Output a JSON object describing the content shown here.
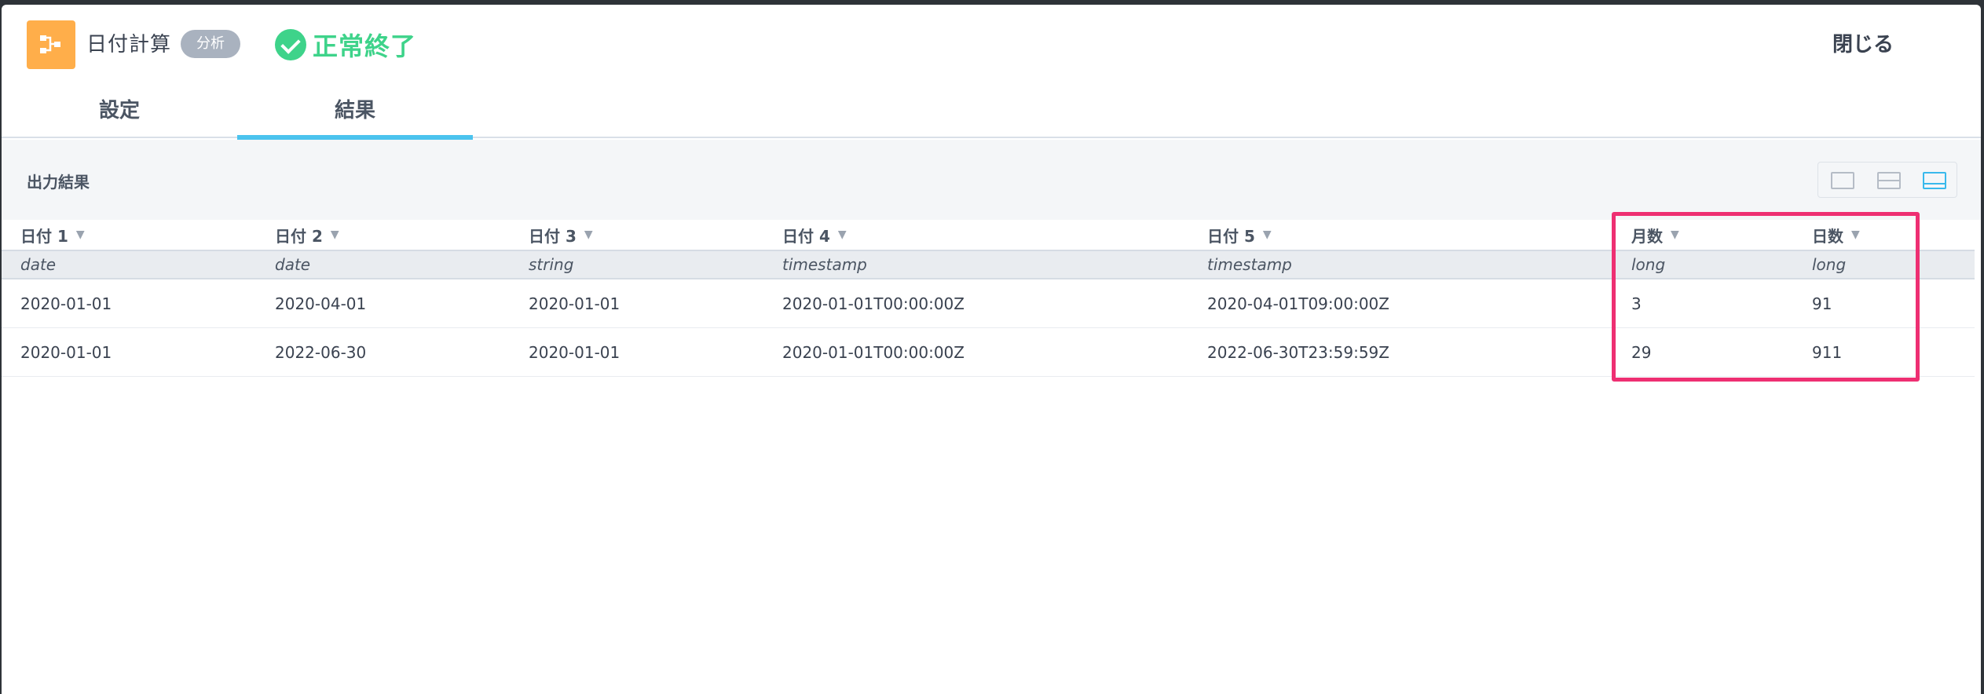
{
  "header": {
    "title": "日付計算",
    "badge": "分析",
    "status": "正常終了",
    "close_label": "閉じる",
    "icon": "flow-node-icon"
  },
  "tabs": [
    {
      "label": "設定",
      "active": false
    },
    {
      "label": "結果",
      "active": true
    }
  ],
  "toolbar": {
    "label": "出力結果",
    "views": [
      "single-pane-icon",
      "split-pane-icon",
      "bottom-pane-icon"
    ],
    "active_view": "bottom-pane-icon"
  },
  "table": {
    "columns": [
      {
        "name": "日付 1",
        "type": "date"
      },
      {
        "name": "日付 2",
        "type": "date"
      },
      {
        "name": "日付 3",
        "type": "string"
      },
      {
        "name": "日付 4",
        "type": "timestamp"
      },
      {
        "name": "日付 5",
        "type": "timestamp"
      },
      {
        "name": "月数",
        "type": "long"
      },
      {
        "name": "日数",
        "type": "long"
      }
    ],
    "rows": [
      [
        "2020-01-01",
        "2020-04-01",
        "2020-01-01",
        "2020-01-01T00:00:00Z",
        "2020-04-01T09:00:00Z",
        "3",
        "91"
      ],
      [
        "2020-01-01",
        "2022-06-30",
        "2020-01-01",
        "2020-01-01T00:00:00Z",
        "2022-06-30T23:59:59Z",
        "29",
        "911"
      ]
    ],
    "sort_glyph": "▼"
  },
  "colors": {
    "accent": "#4bc3ee",
    "success": "#3ed38a",
    "icon_bg": "#ffae4a",
    "highlight": "#ee2f72"
  }
}
